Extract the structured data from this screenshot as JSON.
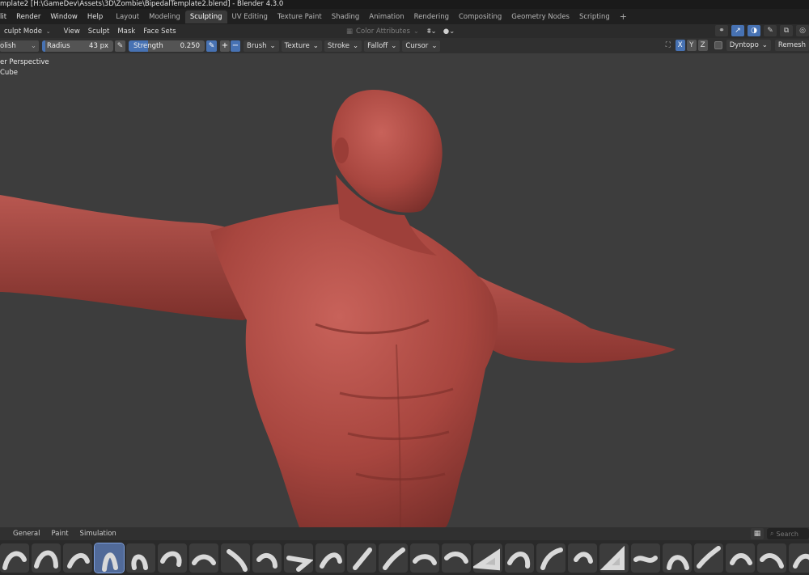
{
  "window": {
    "title": "mplate2 [H:\\GameDev\\Assets\\3D\\Zombie\\BipedalTemplate2.blend] - Blender 4.3.0"
  },
  "menubar": {
    "items": [
      "lit",
      "Render",
      "Window",
      "Help"
    ],
    "workspaces": [
      "Layout",
      "Modeling",
      "Sculpting",
      "UV Editing",
      "Texture Paint",
      "Shading",
      "Animation",
      "Rendering",
      "Compositing",
      "Geometry Nodes",
      "Scripting"
    ],
    "active_workspace": "Sculpting",
    "add_label": "+"
  },
  "header1": {
    "mode": "culpt Mode",
    "menus": [
      "View",
      "Sculpt",
      "Mask",
      "Face Sets"
    ],
    "color_attributes": "Color Attributes"
  },
  "header2": {
    "brush": "olish",
    "radius_label": "Radius",
    "radius_value": "43 px",
    "strength_label": "Strength",
    "strength_value": "0.250",
    "strength_fraction": 0.25,
    "plus": "+",
    "minus": "−",
    "dropdowns": [
      "Brush",
      "Texture",
      "Stroke",
      "Falloff",
      "Cursor"
    ],
    "axes": [
      "X",
      "Y",
      "Z"
    ],
    "dyntopo": "Dyntopo",
    "remesh": "Remesh"
  },
  "viewport": {
    "view_label": "er Perspective",
    "object_label": "Cube",
    "model_color": "#a8463f"
  },
  "asset_shelf": {
    "tabs": [
      "General",
      "Paint",
      "Simulation"
    ],
    "search_placeholder": "Search"
  },
  "colors": {
    "accent": "#4772b3",
    "background": "#3d3d3d"
  }
}
